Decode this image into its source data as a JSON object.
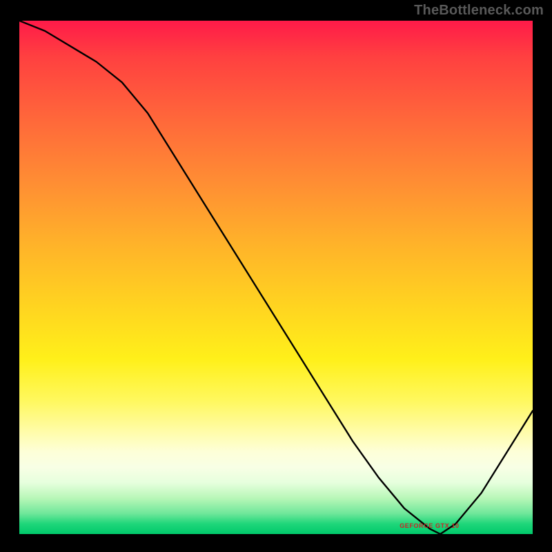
{
  "attribution": "TheBottleneck.com",
  "chart_data": {
    "type": "line",
    "title": "",
    "xlabel": "",
    "ylabel": "",
    "xlim": [
      0,
      100
    ],
    "ylim": [
      0,
      100
    ],
    "grid": false,
    "legend": false,
    "background": {
      "kind": "vertical-gradient",
      "stops": [
        {
          "pos": 0,
          "color": "#ff1a49"
        },
        {
          "pos": 20,
          "color": "#ff6a3a"
        },
        {
          "pos": 44,
          "color": "#ffb429"
        },
        {
          "pos": 66,
          "color": "#fff01a"
        },
        {
          "pos": 84,
          "color": "#fdffd8"
        },
        {
          "pos": 100,
          "color": "#00c96b"
        }
      ]
    },
    "series": [
      {
        "name": "bottleneck-curve",
        "x": [
          0,
          5,
          10,
          15,
          20,
          25,
          30,
          35,
          40,
          45,
          50,
          55,
          60,
          65,
          70,
          75,
          80,
          82,
          85,
          90,
          95,
          100
        ],
        "y": [
          100,
          98,
          95,
          92,
          88,
          82,
          74,
          66,
          58,
          50,
          42,
          34,
          26,
          18,
          11,
          5,
          1,
          0,
          2,
          8,
          16,
          24
        ]
      }
    ],
    "annotations": [
      {
        "name": "minima-label",
        "text": "GEFORCE GTX 10",
        "x": 80,
        "y": 1.5,
        "color": "#cc2a2a"
      }
    ]
  }
}
